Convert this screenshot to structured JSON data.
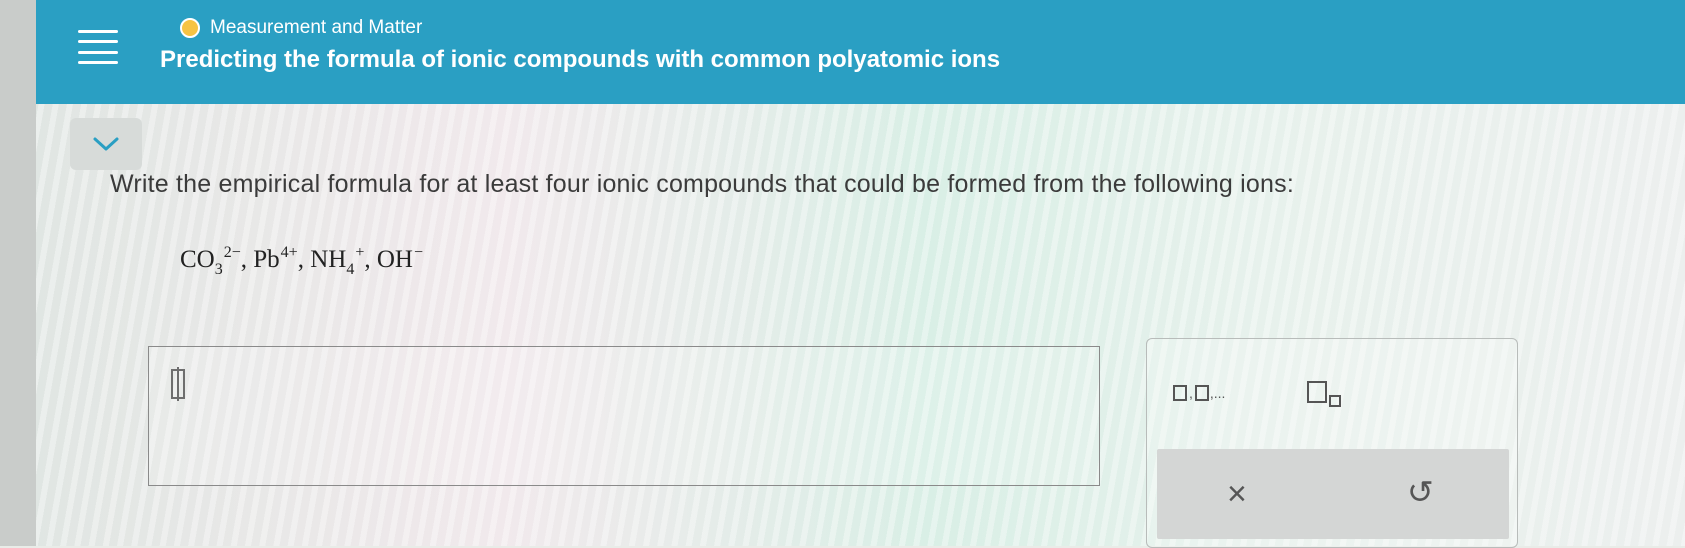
{
  "header": {
    "topic": "Measurement and Matter",
    "title": "Predicting the formula of ionic compounds with common polyatomic ions",
    "accent_color": "#2a9fc3",
    "status_dot_color": "#f6c343"
  },
  "question": {
    "prompt": "Write the empirical formula for at least four ionic compounds that could be formed from the following ions:",
    "ions": [
      {
        "base": "CO",
        "sub": "3",
        "sup": "2−"
      },
      {
        "base": "Pb",
        "sub": "",
        "sup": "4+"
      },
      {
        "base": "NH",
        "sub": "4",
        "sup": "+"
      },
      {
        "base": "OH",
        "sub": "",
        "sup": "−"
      }
    ]
  },
  "answer": {
    "value": ""
  },
  "tools": {
    "list_button_suffix": ",...",
    "clear_symbol": "×",
    "undo_symbol": "↺"
  },
  "icons": [
    "menu-icon",
    "chevron-down-icon",
    "list-template-icon",
    "subscript-template-icon",
    "clear-icon",
    "undo-icon"
  ]
}
